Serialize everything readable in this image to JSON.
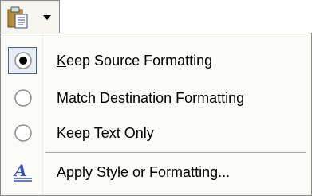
{
  "paste_options": {
    "button_icon": "clipboard-paste-icon",
    "dropdown_icon": "chevron-down-icon"
  },
  "menu": {
    "items": [
      {
        "label": "Keep Source Formatting",
        "accesskey": "K",
        "selected": true,
        "icon": "radio-selected-icon"
      },
      {
        "label": "Match Destination Formatting",
        "accesskey": "D",
        "selected": false,
        "icon": "radio-empty-icon"
      },
      {
        "label": "Keep Text Only",
        "accesskey": "T",
        "selected": false,
        "icon": "radio-empty-icon"
      }
    ],
    "style_item": {
      "label": "Apply Style or Formatting...",
      "accesskey": "A",
      "icon": "styles-icon"
    }
  },
  "colors": {
    "accent": "#4a5f8a",
    "menu_background": "#fbfbf8",
    "border": "#8a8a84"
  }
}
